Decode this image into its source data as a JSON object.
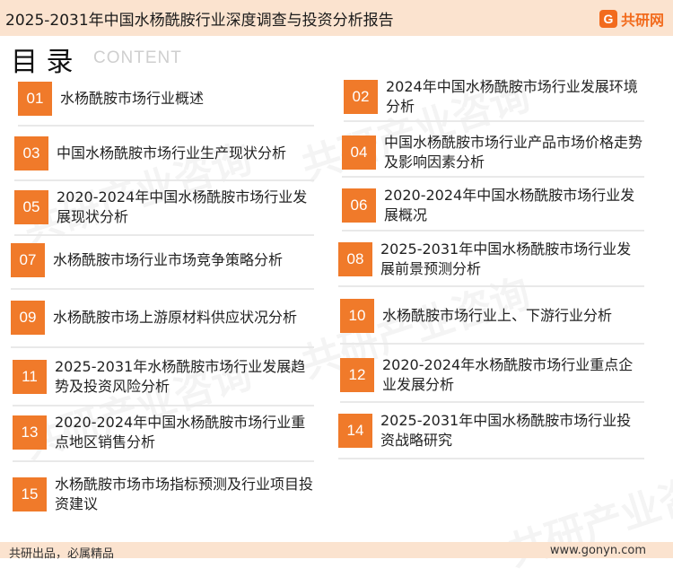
{
  "header": {
    "title": "2025-2031年中国水杨酰胺行业深度调查与投资分析报告",
    "logo_text": "共研网"
  },
  "toc": {
    "heading": "目 录",
    "subheading": "CONTENT"
  },
  "watermark": "共研产业咨询",
  "accent_color": "#f07a2a",
  "items": [
    {
      "num": "01",
      "text": "水杨酰胺市场行业概述"
    },
    {
      "num": "02",
      "text": "2024年中国水杨酰胺市场行业发展环境分析"
    },
    {
      "num": "03",
      "text": "中国水杨酰胺市场行业生产现状分析"
    },
    {
      "num": "04",
      "text": "中国水杨酰胺市场行业产品市场价格走势及影响因素分析"
    },
    {
      "num": "05",
      "text": "2020-2024年中国水杨酰胺市场行业发展现状分析"
    },
    {
      "num": "06",
      "text": "2020-2024年中国水杨酰胺市场行业发展概况"
    },
    {
      "num": "07",
      "text": "水杨酰胺市场行业市场竞争策略分析"
    },
    {
      "num": "08",
      "text": "2025-2031年中国水杨酰胺市场行业发展前景预测分析"
    },
    {
      "num": "09",
      "text": "水杨酰胺市场上游原材料供应状况分析"
    },
    {
      "num": "10",
      "text": "水杨酰胺市场行业上、下游行业分析"
    },
    {
      "num": "11",
      "text": "2025-2031年水杨酰胺市场行业发展趋势及投资风险分析"
    },
    {
      "num": "12",
      "text": "2020-2024年水杨酰胺市场行业重点企业发展分析"
    },
    {
      "num": "13",
      "text": "2020-2024年中国水杨酰胺市场行业重点地区销售分析"
    },
    {
      "num": "14",
      "text": "2025-2031年中国水杨酰胺市场行业投资战略研究"
    },
    {
      "num": "15",
      "text": "水杨酰胺市场市场指标预测及行业项目投资建议"
    }
  ],
  "footer": {
    "left": "共研出品，必属精品",
    "right": "www.gonyn.com"
  }
}
